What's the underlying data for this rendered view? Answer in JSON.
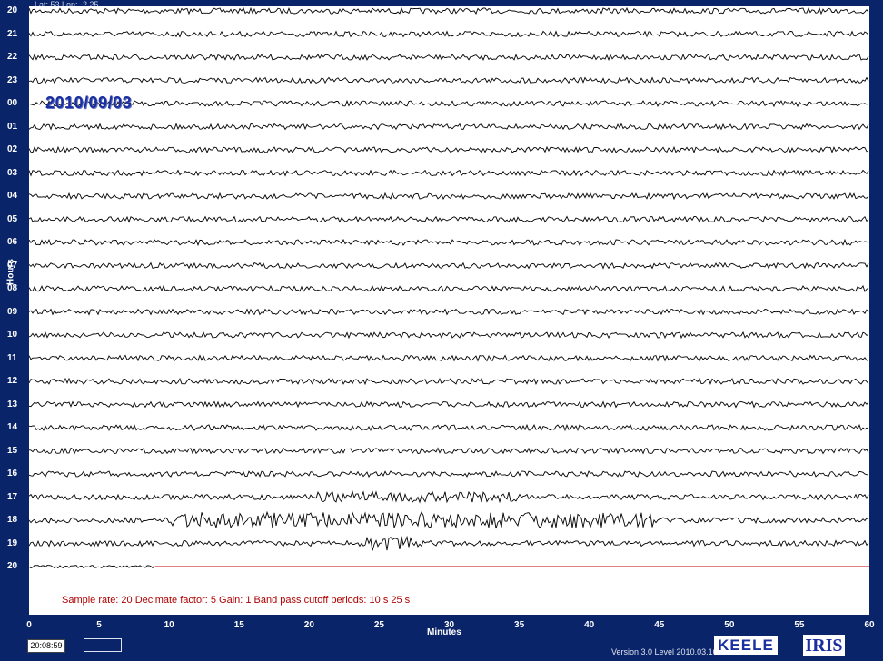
{
  "location": "Lat: 53 Lon: -2.25",
  "date": "2010/09/03",
  "y_axis_label": "Hours",
  "hour_labels": [
    "20",
    "21",
    "22",
    "23",
    "00",
    "01",
    "02",
    "03",
    "04",
    "05",
    "06",
    "07",
    "08",
    "09",
    "10",
    "11",
    "12",
    "13",
    "14",
    "15",
    "16",
    "17",
    "18",
    "19",
    "20"
  ],
  "info_line": "Sample rate: 20  Decimate factor: 5  Gain: 1  Band pass cutoff periods: 10 s 25 s",
  "x_axis_label": "Minutes",
  "x_ticks": [
    "0",
    "5",
    "10",
    "15",
    "20",
    "25",
    "30",
    "35",
    "40",
    "45",
    "50",
    "55",
    "60"
  ],
  "current_time": "20:08:59",
  "version": "Version 3.0 Level 2010.03.16",
  "logos": {
    "keele": "KEELE",
    "iris": "IRIS"
  },
  "colors": {
    "background": "#0a246a",
    "trace": "#000000",
    "info_text": "#b00000",
    "date_text": "#1a2fa0",
    "current_line": "#c00000"
  },
  "current_trace_minutes": 9
}
